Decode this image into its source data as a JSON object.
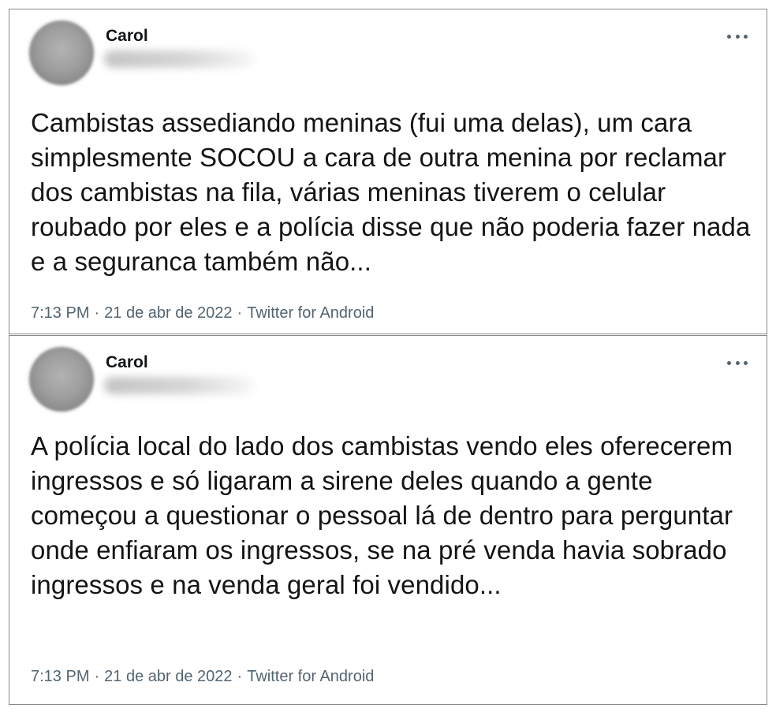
{
  "tweets": [
    {
      "author": "Carol",
      "text": "Cambistas assediando meninas (fui uma delas), um cara simplesmente SOCOU a cara de outra menina por reclamar dos cambistas na fila, várias meninas tiverem o celular roubado por eles e a polícia disse que não poderia fazer nada e a seguranca também não...",
      "time": "7:13 PM",
      "date": "21 de abr de 2022",
      "source": "Twitter for Android",
      "separator": "·",
      "more_icon": "more-horizontal-icon"
    },
    {
      "author": "Carol",
      "text": "A polícia local do lado dos cambistas vendo eles oferecerem ingressos e só ligaram a sirene deles quando a gente começou a questionar o pessoal lá de dentro para perguntar onde enfiaram os ingressos, se na pré venda havia sobrado ingressos e na venda geral foi vendido...",
      "time": "7:13 PM",
      "date": "21 de abr de 2022",
      "source": "Twitter for Android",
      "separator": "·",
      "more_icon": "more-horizontal-icon"
    }
  ]
}
